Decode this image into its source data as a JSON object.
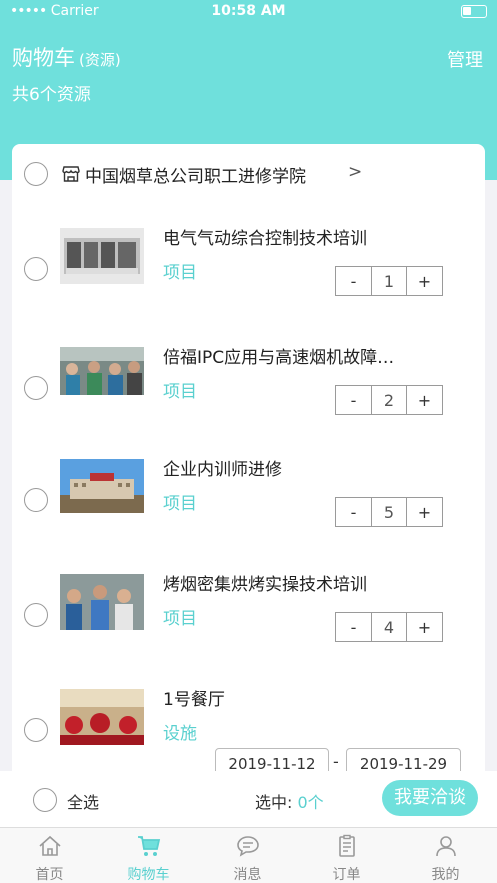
{
  "status_bar": {
    "carrier": "Carrier",
    "time": "10:58 AM"
  },
  "header": {
    "title": "购物车",
    "subtitle": "(资源)",
    "manage": "管理",
    "count_text": "共6个资源"
  },
  "shop": {
    "name": "中国烟草总公司职工进修学院",
    "chevron": ">"
  },
  "items": [
    {
      "title": "电气气动综合控制技术培训",
      "type": "项目",
      "quantity": "1"
    },
    {
      "title": "倍福IPC应用与高速烟机故障…",
      "type": "项目",
      "quantity": "2"
    },
    {
      "title": "企业内训师进修",
      "type": "项目",
      "quantity": "5"
    },
    {
      "title": "烤烟密集烘烤实操技术培训",
      "type": "项目",
      "quantity": "4"
    },
    {
      "title": "1号餐厅",
      "type": "设施",
      "start_date": "2019-11-12",
      "date_separator": "-",
      "end_date": "2019-11-29"
    }
  ],
  "stepper": {
    "minus": "-",
    "plus": "+"
  },
  "bottom_bar": {
    "select_all": "全选",
    "selected_label": "选中: ",
    "selected_count": "0个",
    "action": "我要洽谈"
  },
  "tabs": [
    {
      "label": "首页",
      "icon": "home-icon"
    },
    {
      "label": "购物车",
      "icon": "cart-icon",
      "active": true
    },
    {
      "label": "消息",
      "icon": "message-icon"
    },
    {
      "label": "订单",
      "icon": "order-icon"
    },
    {
      "label": "我的",
      "icon": "user-icon"
    }
  ],
  "colors": {
    "accent": "#6fe0dc",
    "accent_text": "#5ad0cf"
  }
}
